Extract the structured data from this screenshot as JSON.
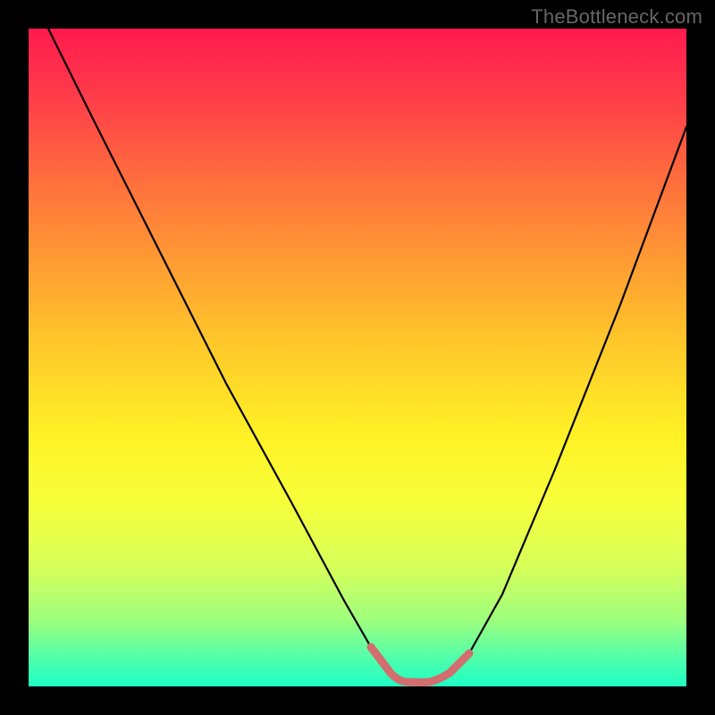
{
  "watermark": "TheBottleneck.com",
  "chart_data": {
    "type": "line",
    "title": "",
    "xlabel": "",
    "ylabel": "",
    "xlim": [
      0,
      100
    ],
    "ylim": [
      0,
      100
    ],
    "grid": false,
    "legend": false,
    "series": [
      {
        "name": "main-curve",
        "color": "#000000",
        "x": [
          3,
          10,
          20,
          30,
          40,
          48,
          52,
          55,
          58,
          61,
          64,
          67,
          72,
          80,
          90,
          100
        ],
        "y": [
          100,
          86,
          66,
          46,
          28,
          13,
          6,
          2,
          1,
          1,
          2,
          5,
          14,
          33,
          58,
          85
        ]
      },
      {
        "name": "bottom-highlight",
        "color": "#d26e6e",
        "x": [
          52,
          55,
          58,
          61,
          64,
          67
        ],
        "y": [
          6,
          2,
          1,
          1,
          2,
          5
        ]
      }
    ],
    "background_gradient": {
      "top": "#ff1a4d",
      "middle": "#fff226",
      "bottom": "#1effc4"
    }
  }
}
